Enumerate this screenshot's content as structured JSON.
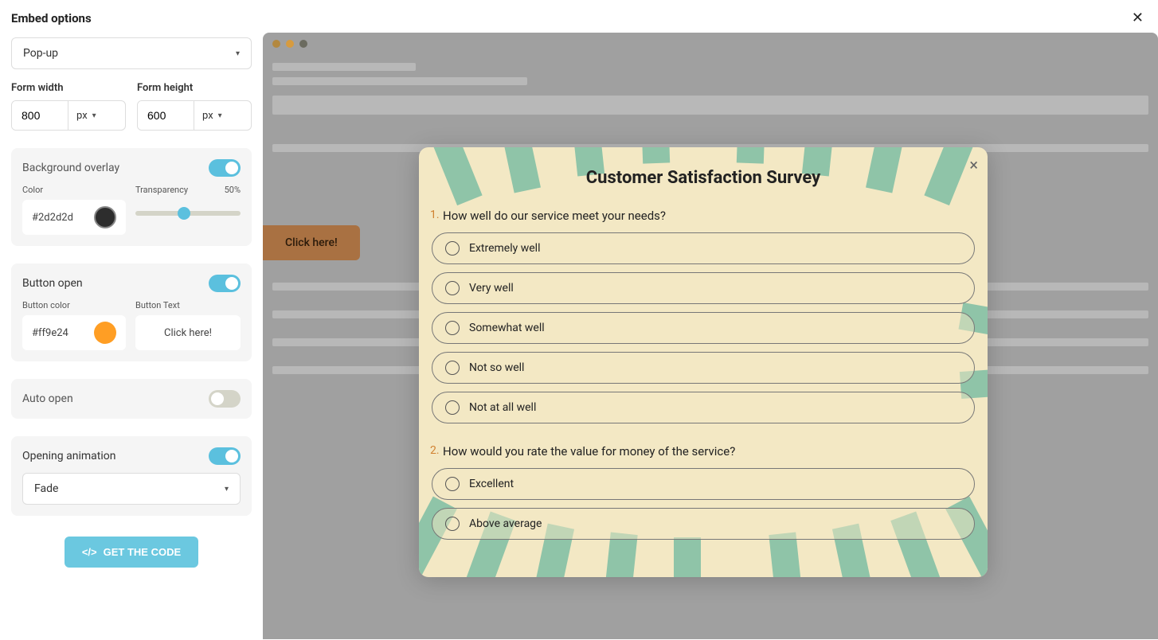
{
  "header": {
    "title": "Embed options"
  },
  "embedType": "Pop-up",
  "formWidth": {
    "label": "Form width",
    "value": "800",
    "unit": "px"
  },
  "formHeight": {
    "label": "Form height",
    "value": "600",
    "unit": "px"
  },
  "bgOverlay": {
    "title": "Background overlay",
    "enabled": true,
    "colorLabel": "Color",
    "colorHex": "#2d2d2d",
    "transparencyLabel": "Transparency",
    "transparencyValue": "50%"
  },
  "buttonOpen": {
    "title": "Button open",
    "enabled": true,
    "colorLabel": "Button color",
    "colorHex": "#ff9e24",
    "textLabel": "Button Text",
    "textValue": "Click here!"
  },
  "autoOpen": {
    "title": "Auto open",
    "enabled": false
  },
  "animation": {
    "title": "Opening animation",
    "enabled": true,
    "value": "Fade"
  },
  "getCode": "GET THE CODE",
  "preview": {
    "clickHere": "Click here!",
    "survey": {
      "title": "Customer Satisfaction Survey",
      "q1": {
        "num": "1.",
        "text": "How well do our service meet your needs?",
        "opts": [
          "Extremely well",
          "Very well",
          "Somewhat well",
          "Not so well",
          "Not at all well"
        ]
      },
      "q2": {
        "num": "2.",
        "text": "How would you rate the value for money of the service?",
        "opts": [
          "Excellent",
          "Above average"
        ]
      }
    }
  }
}
